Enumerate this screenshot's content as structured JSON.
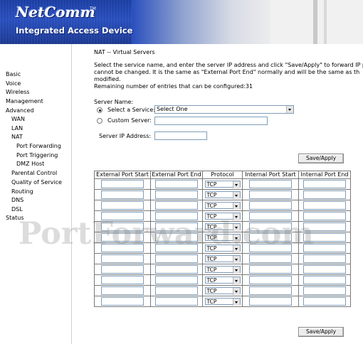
{
  "header": {
    "logo_text": "NetComm",
    "logo_tm": "TM",
    "tagline": "Integrated Access Device"
  },
  "sidebar": {
    "items": [
      {
        "label": "Basic"
      },
      {
        "label": "Voice"
      },
      {
        "label": "Wireless"
      },
      {
        "label": "Management"
      },
      {
        "label": "Advanced"
      },
      {
        "label": "WAN"
      },
      {
        "label": "LAN"
      },
      {
        "label": "NAT"
      },
      {
        "label": "Port Forwarding"
      },
      {
        "label": "Port Triggering"
      },
      {
        "label": "DMZ Host"
      },
      {
        "label": "Parental Control"
      },
      {
        "label": "Quality of Service"
      },
      {
        "label": "Routing"
      },
      {
        "label": "DNS"
      },
      {
        "label": "DSL"
      },
      {
        "label": "Status"
      }
    ]
  },
  "main": {
    "title": "NAT -- Virtual Servers",
    "desc_line1": "Select the service name, and enter the server IP address and click \"Save/Apply\" to forward IP packets fo",
    "desc_line2": "cannot be changed. It is the same as \"External Port End\" normally and will be the same as th",
    "desc_line3": "modified.",
    "remaining": "Remaining number of entries that can be configured:31",
    "server_name_label": "Server Name:",
    "select_service_label": "Select a Service:",
    "select_service_value": "Select One",
    "custom_server_label": "Custom Server:",
    "server_ip_label": "Server IP Address:",
    "save_apply": "Save/Apply",
    "table": {
      "headers": [
        "External Port Start",
        "External Port End",
        "Protocol",
        "Internal Port Start",
        "Internal Port End"
      ],
      "row_count": 12,
      "protocol_default": "TCP"
    }
  },
  "watermark": "PortForward.com",
  "colors": {
    "banner_blue": "#294fbd",
    "input_border": "#7f9db9"
  }
}
